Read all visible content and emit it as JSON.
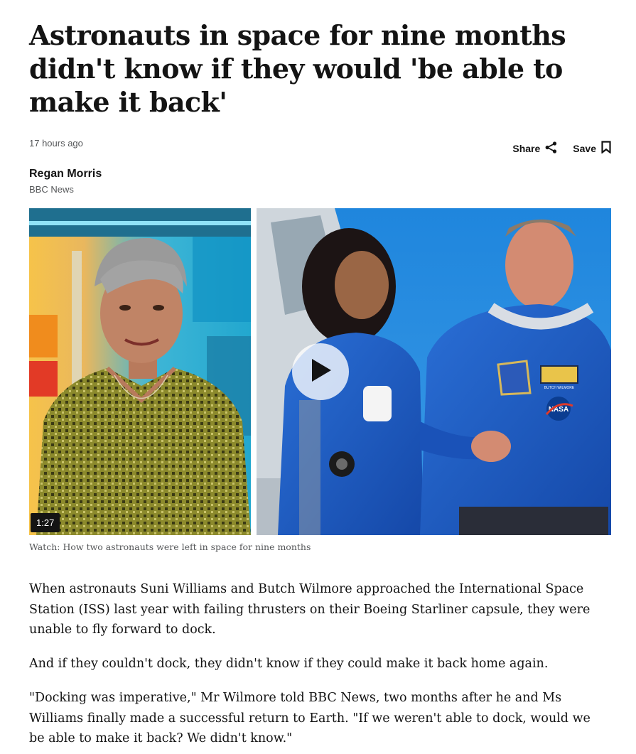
{
  "article": {
    "headline": "Astronauts in space for nine months didn't know if they would 'be able to make it back'",
    "timestamp": "17 hours ago",
    "share_label": "Share",
    "save_label": "Save",
    "author": "Regan Morris",
    "organization": "BBC News"
  },
  "media": {
    "duration": "1:27",
    "caption": "Watch: How two astronauts were left in space for nine months",
    "badges": {
      "name_patch": "BUTCH WILMORE",
      "nasa_logo": "NASA"
    }
  },
  "body": {
    "paragraphs": [
      "When astronauts Suni Williams and Butch Wilmore approached the International Space Station (ISS) last year with failing thrusters on their Boeing Starliner capsule, they were unable to fly forward to dock.",
      "And if they couldn't dock, they didn't know if they could make it back home again.",
      "\"Docking was imperative,\" Mr Wilmore told BBC News, two months after he and Ms Williams finally made a successful return to Earth. \"If we weren't able to dock, would we be able to make it back? We didn't know.\""
    ]
  },
  "icons": [
    "share-icon",
    "bookmark-icon",
    "play-icon"
  ]
}
